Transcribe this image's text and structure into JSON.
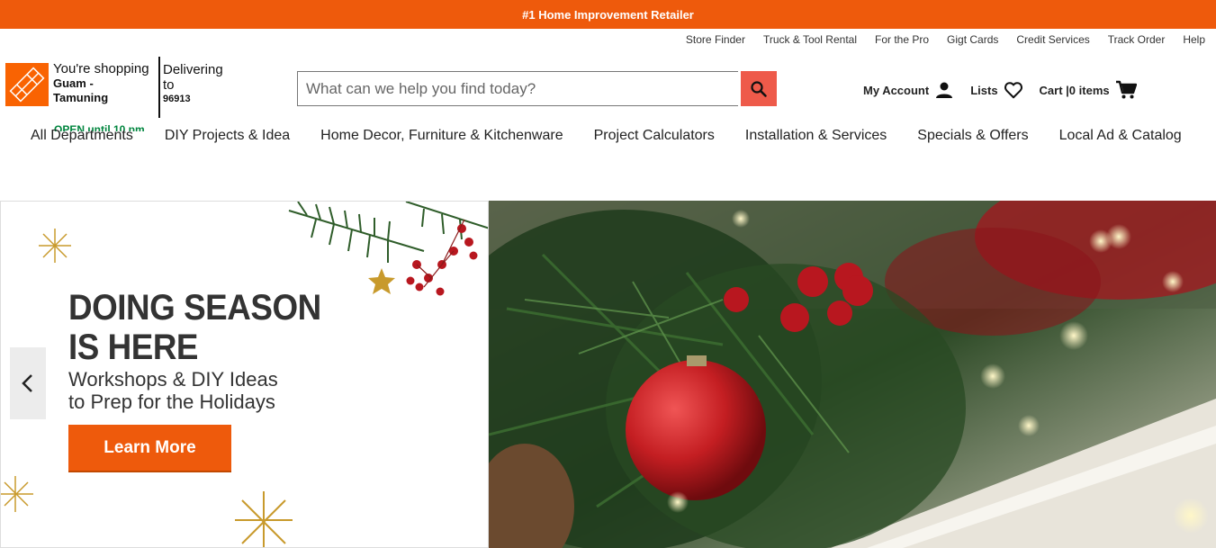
{
  "banner": {
    "text": "#1 Home Improvement Retailer"
  },
  "utility_nav": [
    "Store Finder",
    "Truck & Tool Rental",
    "For the Pro",
    "Gigt Cards",
    "Credit Services",
    "Track Order",
    "Help"
  ],
  "store": {
    "label": "You're shopping",
    "name_line1": "Guam -",
    "name_line2": "Tamuning",
    "hours": "OPEN until 10 pm"
  },
  "delivery": {
    "label_line1": "Delivering",
    "label_line2": "to",
    "zip": "96913"
  },
  "search": {
    "placeholder": "What can we help you find today?",
    "value": ""
  },
  "header_actions": {
    "account": "My Account",
    "lists": "Lists",
    "cart": "Cart |0 items"
  },
  "main_nav": [
    "All Departments",
    "DIY Projects & Idea",
    "Home Decor, Furniture & Kitchenware",
    "Project Calculators",
    "Installation & Services",
    "Specials & Offers",
    "Local Ad & Catalog"
  ],
  "hero": {
    "headline_line1": "DOING SEASON",
    "headline_line2": "IS HERE",
    "sub_line1": "Workshops & DIY Ideas",
    "sub_line2": "to Prep for the Holidays",
    "cta": "Learn More"
  },
  "colors": {
    "brand_orange": "#f96302",
    "banner_orange": "#ee5a0c",
    "search_button": "#ee5a4a",
    "open_green": "#00853e"
  },
  "icons": {
    "search": "search-icon",
    "account": "person-icon",
    "lists": "heart-icon",
    "cart": "cart-icon",
    "prev": "chevron-left-icon"
  }
}
